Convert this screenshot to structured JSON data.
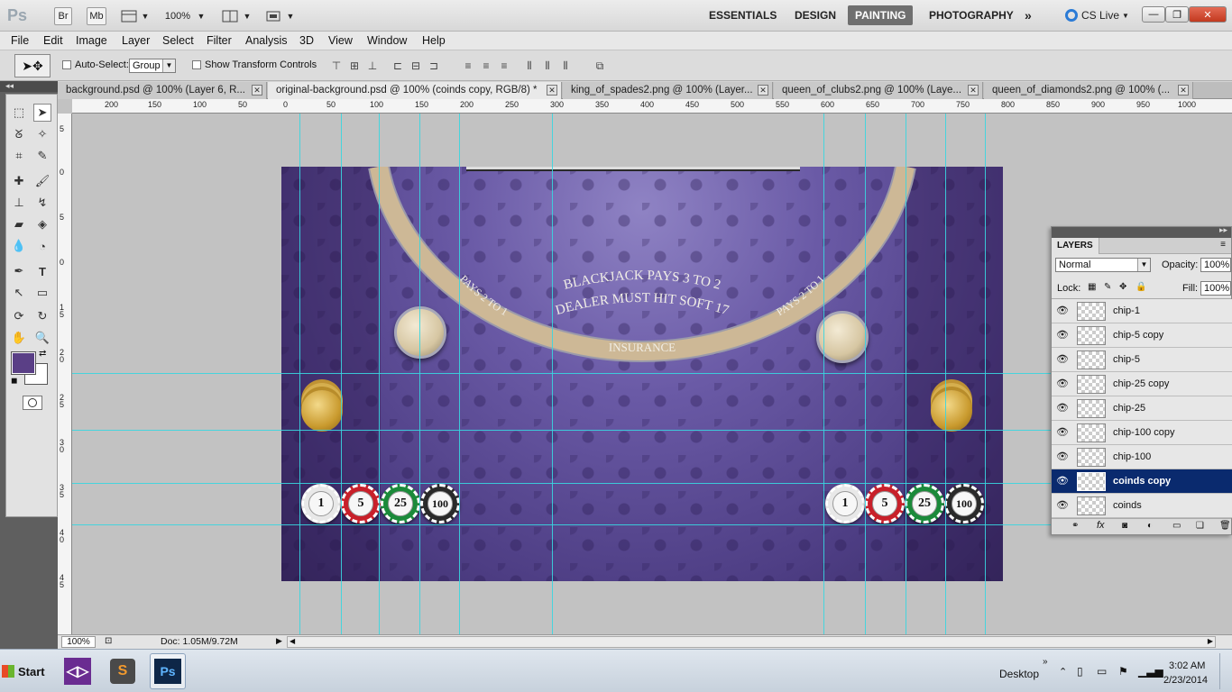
{
  "app": {
    "logo": "Ps",
    "bridge_label": "Br",
    "minibridge_label": "Mb",
    "zoom_value": "100%",
    "workspaces": [
      "ESSENTIALS",
      "DESIGN",
      "PAINTING",
      "PHOTOGRAPHY"
    ],
    "active_workspace": "PAINTING",
    "cs_live": "CS Live"
  },
  "menu": [
    "File",
    "Edit",
    "Image",
    "Layer",
    "Select",
    "Filter",
    "Analysis",
    "3D",
    "View",
    "Window",
    "Help"
  ],
  "options": {
    "auto_select_label": "Auto-Select:",
    "auto_select_value": "Group",
    "transform_label": "Show Transform Controls"
  },
  "tabs": [
    {
      "label": "background.psd @ 100% (Layer 6, R..."
    },
    {
      "label": "original-background.psd @ 100% (coinds copy, RGB/8) *"
    },
    {
      "label": "king_of_spades2.png @ 100% (Layer..."
    },
    {
      "label": "queen_of_clubs2.png @ 100% (Laye..."
    },
    {
      "label": "queen_of_diamonds2.png @ 100% (..."
    }
  ],
  "ruler_h": [
    "200",
    "150",
    "100",
    "50",
    "0",
    "50",
    "100",
    "150",
    "200",
    "250",
    "300",
    "350",
    "400",
    "450",
    "500",
    "550",
    "600",
    "650",
    "700",
    "750",
    "800",
    "850",
    "900",
    "950",
    "1000"
  ],
  "ruler_v": [
    "5",
    "0",
    "5",
    "0",
    "1",
    "5",
    "2",
    "0",
    "2",
    "5",
    "3",
    "0",
    "3",
    "5",
    "4",
    "0",
    "4",
    "5"
  ],
  "table": {
    "line1": "BLACKJACK PAYS 3 TO 2",
    "line2": "DEALER MUST  HIT SOFT 17",
    "insurance": "INSURANCE",
    "pays_left": "PAYS 2 TO 1",
    "pays_right": "PAYS 2 TO 1",
    "chips_left": [
      "1",
      "5",
      "25",
      "100"
    ],
    "chips_right": [
      "1",
      "5",
      "25",
      "100"
    ],
    "chip_colors": [
      "#e8e8e8",
      "#c8202a",
      "#1b8a3a",
      "#2a2a2a"
    ],
    "felt_color": "#5b4b96"
  },
  "status": {
    "zoom": "100%",
    "doc": "Doc: 1.05M/9.72M"
  },
  "layers_panel": {
    "tab": "LAYERS",
    "blend_mode": "Normal",
    "opacity_label": "Opacity:",
    "opacity_value": "100%",
    "lock_label": "Lock:",
    "fill_label": "Fill:",
    "fill_value": "100%",
    "layers": [
      {
        "name": "chip-1"
      },
      {
        "name": "chip-5 copy"
      },
      {
        "name": "chip-5"
      },
      {
        "name": "chip-25 copy"
      },
      {
        "name": "chip-25"
      },
      {
        "name": "chip-100 copy"
      },
      {
        "name": "chip-100"
      },
      {
        "name": "coinds copy"
      },
      {
        "name": "coinds"
      }
    ],
    "selected_layer": "coinds copy"
  },
  "taskbar": {
    "start": "Start",
    "desktop": "Desktop",
    "time": "3:02 AM",
    "date": "2/23/2014",
    "ps_label": "Ps"
  },
  "colors": {
    "foreground": "#5a3f86",
    "background": "#ffffff",
    "guide": "#38d6e0",
    "selection": "#0a2a6e"
  }
}
